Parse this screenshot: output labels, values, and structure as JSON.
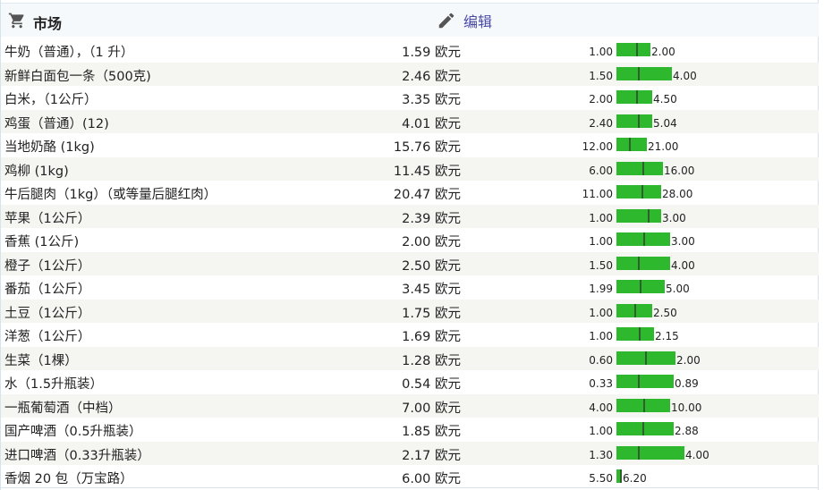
{
  "header": {
    "title": "市场",
    "edit_label": "编辑",
    "icons": {
      "cart": "cart-icon",
      "edit": "pencil-icon"
    },
    "accent_color": "#4a4aa8"
  },
  "bar_color": "#2eb82e",
  "marker_color": "#2f5f2f",
  "items": [
    {
      "name": "牛奶（普通），（1 升）",
      "price": "1.59 欧元",
      "min": "1.00",
      "max": "2.00",
      "mark": 0.59
    },
    {
      "name": "新鲜白面包一条（500克)",
      "price": "2.46 欧元",
      "min": "1.50",
      "max": "4.00",
      "mark": 0.38
    },
    {
      "name": "白米，（1公斤）",
      "price": "3.35 欧元",
      "min": "2.00",
      "max": "4.50",
      "mark": 0.54
    },
    {
      "name": "鸡蛋（普通）(12)",
      "price": "4.01 欧元",
      "min": "2.40",
      "max": "5.04",
      "mark": 0.61
    },
    {
      "name": "当地奶酪 (1kg)",
      "price": "15.76 欧元",
      "min": "12.00",
      "max": "21.00",
      "mark": 0.42
    },
    {
      "name": "鸡柳 (1kg)",
      "price": "11.45 欧元",
      "min": "6.00",
      "max": "16.00",
      "mark": 0.55
    },
    {
      "name": "牛后腿肉（1kg）（或等量后腿红肉）",
      "price": "20.47 欧元",
      "min": "11.00",
      "max": "28.00",
      "mark": 0.56
    },
    {
      "name": "苹果（1公斤）",
      "price": "2.39 欧元",
      "min": "1.00",
      "max": "3.00",
      "mark": 0.7
    },
    {
      "name": "香蕉 (1公斤)",
      "price": "2.00 欧元",
      "min": "1.00",
      "max": "3.00",
      "mark": 0.5
    },
    {
      "name": "橙子（1公斤）",
      "price": "2.50 欧元",
      "min": "1.50",
      "max": "4.00",
      "mark": 0.4
    },
    {
      "name": "番茄（1公斤）",
      "price": "3.45 欧元",
      "min": "1.99",
      "max": "5.00",
      "mark": 0.49
    },
    {
      "name": "土豆（1公斤）",
      "price": "1.75 欧元",
      "min": "1.00",
      "max": "2.50",
      "mark": 0.5
    },
    {
      "name": "洋葱（1公斤）",
      "price": "1.69 欧元",
      "min": "1.00",
      "max": "2.15",
      "mark": 0.6
    },
    {
      "name": "生菜（1棵）",
      "price": "1.28 欧元",
      "min": "0.60",
      "max": "2.00",
      "mark": 0.49
    },
    {
      "name": "水（1.5升瓶装）",
      "price": "0.54 欧元",
      "min": "0.33",
      "max": "0.89",
      "mark": 0.38
    },
    {
      "name": "一瓶葡萄酒（中档）",
      "price": "7.00 欧元",
      "min": "4.00",
      "max": "10.00",
      "mark": 0.5
    },
    {
      "name": "国产啤酒（0.5升瓶装）",
      "price": "1.85 欧元",
      "min": "1.00",
      "max": "2.88",
      "mark": 0.45
    },
    {
      "name": "进口啤酒（0.33升瓶装）",
      "price": "2.17 欧元",
      "min": "1.30",
      "max": "4.00",
      "mark": 0.32
    },
    {
      "name": "香烟 20 包（万宝路）",
      "price": "6.00 欧元",
      "min": "5.50",
      "max": "6.20",
      "mark": 0.71
    }
  ]
}
